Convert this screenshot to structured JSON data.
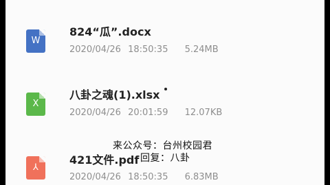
{
  "files": [
    {
      "name": "824“瓜”.docx",
      "date": "2020/04/26",
      "time": "18:50:35",
      "size": "5.24MB",
      "icon": "word-doc-icon",
      "icon_label": "W",
      "color": "#4472c4"
    },
    {
      "name": "八卦之魂(1).xlsx",
      "date": "2020/04/26",
      "time": "20:01:59",
      "size": "12.07KB",
      "icon": "excel-sheet-icon",
      "icon_label": "X",
      "color": "#5bb84a"
    },
    {
      "name": "421文件.pdf",
      "date": "2020/04/26",
      "time": "18:50:35",
      "size": "6.83MB",
      "icon": "pdf-icon",
      "icon_label": "⅄",
      "color": "#f0715b"
    }
  ],
  "overlay": {
    "line1": "来公众号：台州校园君",
    "line2": "回复：八卦"
  }
}
